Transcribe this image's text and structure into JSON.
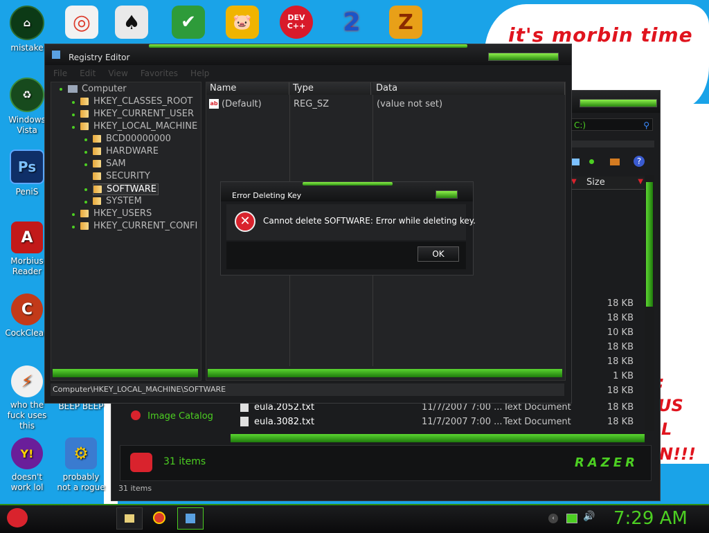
{
  "desktop": {
    "banner_text": "it's morbin time",
    "side_texts": [
      ":",
      "US",
      "L",
      "N!!!"
    ],
    "icons": [
      {
        "label": "mistake",
        "glyph": "⌂",
        "color": "#0c3a16"
      },
      {
        "label": "Windows Vista",
        "glyph": "♻",
        "color": "#174a1d"
      },
      {
        "label": "PeniS",
        "glyph": "Ps",
        "color": "#0f2f68"
      },
      {
        "label": "Morbius Reader",
        "glyph": "A",
        "color": "#c21919"
      },
      {
        "label": "CockClean",
        "glyph": "C",
        "color": "#c23a19"
      },
      {
        "label": "who the fuck uses this",
        "glyph": "⚡",
        "color": "#f0f0f0"
      },
      {
        "label": "doesn't work lol",
        "glyph": "Y!",
        "color": "#6a1e9a"
      },
      {
        "label": "BEEP BEEP",
        "glyph": "",
        "color": "#1aa3e8"
      },
      {
        "label": "probably not a rogue",
        "glyph": "⚙",
        "color": "#3a7bd0"
      }
    ],
    "top_icons": [
      {
        "name": "chrome-icon",
        "glyph": "◎",
        "color": "#dc3b2b"
      },
      {
        "name": "solitaire-icon",
        "glyph": "♠",
        "color": "#e6e6e6"
      },
      {
        "name": "shield-icon",
        "glyph": "✔",
        "color": "#2e9b3a"
      },
      {
        "name": "bad-piggies-icon",
        "glyph": "🐷",
        "color": "#f0b400"
      },
      {
        "name": "devcpp-icon",
        "glyph": "DEV C++",
        "color": "#d81a2a"
      },
      {
        "name": "two-icon",
        "glyph": "2",
        "color": "#1a55c8"
      },
      {
        "name": "z-icon",
        "glyph": "Z",
        "color": "#e8a018"
      }
    ]
  },
  "regedit": {
    "title": "Registry Editor",
    "menu": [
      "File",
      "Edit",
      "View",
      "Favorites",
      "Help"
    ],
    "tree": [
      {
        "label": "Computer",
        "level": 0
      },
      {
        "label": "HKEY_CLASSES_ROOT",
        "level": 1
      },
      {
        "label": "HKEY_CURRENT_USER",
        "level": 1
      },
      {
        "label": "HKEY_LOCAL_MACHINE",
        "level": 1
      },
      {
        "label": "BCD00000000",
        "level": 2
      },
      {
        "label": "HARDWARE",
        "level": 2
      },
      {
        "label": "SAM",
        "level": 2
      },
      {
        "label": "SECURITY",
        "level": 2
      },
      {
        "label": "SOFTWARE",
        "level": 2,
        "selected": true
      },
      {
        "label": "SYSTEM",
        "level": 2
      },
      {
        "label": "HKEY_USERS",
        "level": 1
      },
      {
        "label": "HKEY_CURRENT_CONFI",
        "level": 1
      }
    ],
    "columns": [
      "Name",
      "Type",
      "Data"
    ],
    "values": [
      {
        "name": "(Default)",
        "type": "REG_SZ",
        "data": "(value not set)"
      }
    ],
    "status_path": "Computer\\HKEY_LOCAL_MACHINE\\SOFTWARE"
  },
  "dialog": {
    "title": "Error Deleting Key",
    "message": "Cannot delete SOFTWARE:  Error while deleting key.",
    "ok_label": "OK"
  },
  "explorer": {
    "address_text": "C:)",
    "size_header": "Size",
    "sizes": [
      "18 KB",
      "18 KB",
      "10 KB",
      "18 KB",
      "18 KB",
      "1 KB",
      "18 KB"
    ],
    "files": [
      {
        "name": "eula.2052.txt",
        "date": "11/7/2007 7:00 ...",
        "type": "Text Document",
        "size": "18 KB"
      },
      {
        "name": "eula.3082.txt",
        "date": "11/7/2007 7:00 ...",
        "type": "Text Document",
        "size": "18 KB"
      }
    ],
    "nav_item": "Image Catalog",
    "items_count": "31 items",
    "status_count": "31 items",
    "brand": "RAZER"
  },
  "taskbar": {
    "clock": "7:29 AM"
  },
  "colors": {
    "accent_green": "#4ccf22",
    "desktop_blue": "#1aa3e8",
    "error_red": "#d9232d"
  }
}
